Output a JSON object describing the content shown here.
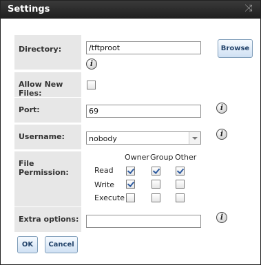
{
  "window": {
    "title": "Settings",
    "close_glyph": "⤨"
  },
  "fields": {
    "directory": {
      "label": "Directory:",
      "value": "/tftproot",
      "browse_label": "Browse"
    },
    "allow_new_files": {
      "label": "Allow New Files:",
      "checked": false
    },
    "port": {
      "label": "Port:",
      "value": "69"
    },
    "username": {
      "label": "Username:",
      "value": "nobody"
    },
    "file_permission": {
      "label": "File Permission:",
      "columns": [
        "Owner",
        "Group",
        "Other"
      ],
      "rows": [
        {
          "name": "Read",
          "values": [
            true,
            true,
            true
          ]
        },
        {
          "name": "Write",
          "values": [
            true,
            false,
            false
          ]
        },
        {
          "name": "Execute",
          "values": [
            false,
            false,
            false
          ]
        }
      ]
    },
    "extra_options": {
      "label": "Extra options:",
      "value": ""
    }
  },
  "buttons": {
    "ok": "OK",
    "cancel": "Cancel"
  },
  "icons": {
    "info": "info-icon",
    "close": "close-icon",
    "dropdown": "chevron-down-icon"
  }
}
